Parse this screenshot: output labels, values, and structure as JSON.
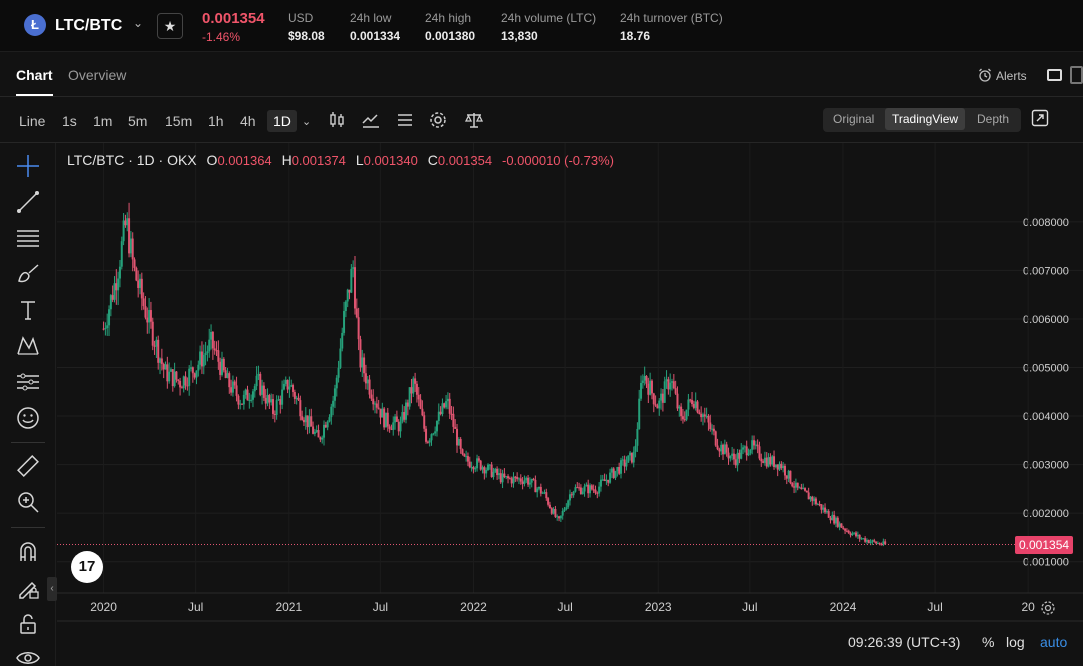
{
  "ticker": {
    "icon_letter": "Ł",
    "pair": "LTC/BTC",
    "price": "0.001354",
    "change": "-1.46%",
    "stats": [
      {
        "label": "USD",
        "value": "$98.08"
      },
      {
        "label": "24h low",
        "value": "0.001334"
      },
      {
        "label": "24h high",
        "value": "0.001380"
      },
      {
        "label": "24h volume (LTC)",
        "value": "13,830"
      },
      {
        "label": "24h turnover (BTC)",
        "value": "18.76"
      }
    ]
  },
  "tabs": {
    "chart": "Chart",
    "overview": "Overview",
    "alerts": "Alerts"
  },
  "toolbar": {
    "timeframes": [
      "Line",
      "1s",
      "1m",
      "5m",
      "15m",
      "1h",
      "4h",
      "1D"
    ],
    "views": [
      "Original",
      "TradingView",
      "Depth"
    ]
  },
  "legend": {
    "symbol": "LTC/BTC · 1D · OKX",
    "o_label": "O",
    "o": "0.001364",
    "h_label": "H",
    "h": "0.001374",
    "l_label": "L",
    "l": "0.001340",
    "c_label": "C",
    "c": "0.001354",
    "change": "-0.000010 (-0.73%)"
  },
  "status": {
    "time": "09:26:39 (UTC+3)",
    "percent": "%",
    "log": "log",
    "auto": "auto"
  },
  "tv_logo": "17",
  "colors": {
    "up": "#26a17b",
    "down": "#e05571",
    "accent": "#f0556a"
  },
  "chart_data": {
    "type": "candlestick",
    "title": "LTC/BTC · 1D · OKX",
    "y_ticks": [
      "0.008000",
      "0.007000",
      "0.006000",
      "0.005000",
      "0.004000",
      "0.003000",
      "0.002000",
      "0.001000"
    ],
    "ylim": [
      0.0005,
      0.0088
    ],
    "x_ticks": [
      "2020",
      "Jul",
      "2021",
      "Jul",
      "2022",
      "Jul",
      "2023",
      "Jul",
      "2024",
      "Jul",
      "20"
    ],
    "xlim": [
      "2019-10-01",
      "2024-11-30"
    ],
    "last_price": "0.001354",
    "series_outline": [
      [
        "2020-01-01",
        0.0058
      ],
      [
        "2020-01-25",
        0.0068
      ],
      [
        "2020-02-15",
        0.008
      ],
      [
        "2020-03-01",
        0.007
      ],
      [
        "2020-03-20",
        0.0063
      ],
      [
        "2020-04-10",
        0.0056
      ],
      [
        "2020-05-01",
        0.0049
      ],
      [
        "2020-06-01",
        0.0047
      ],
      [
        "2020-07-01",
        0.005
      ],
      [
        "2020-08-01",
        0.0055
      ],
      [
        "2020-09-01",
        0.0047
      ],
      [
        "2020-10-01",
        0.0043
      ],
      [
        "2020-11-01",
        0.0047
      ],
      [
        "2020-12-01",
        0.0041
      ],
      [
        "2021-01-01",
        0.0047
      ],
      [
        "2021-02-01",
        0.004
      ],
      [
        "2021-03-01",
        0.0035
      ],
      [
        "2021-04-01",
        0.0044
      ],
      [
        "2021-04-20",
        0.006
      ],
      [
        "2021-05-08",
        0.0071
      ],
      [
        "2021-05-20",
        0.0052
      ],
      [
        "2021-06-10",
        0.0046
      ],
      [
        "2021-07-10",
        0.0039
      ],
      [
        "2021-08-10",
        0.0038
      ],
      [
        "2021-09-05",
        0.0047
      ],
      [
        "2021-10-01",
        0.0035
      ],
      [
        "2021-11-10",
        0.0043
      ],
      [
        "2021-12-10",
        0.0031
      ],
      [
        "2022-01-15",
        0.003
      ],
      [
        "2022-03-01",
        0.0027
      ],
      [
        "2022-04-15",
        0.0027
      ],
      [
        "2022-05-20",
        0.0024
      ],
      [
        "2022-06-18",
        0.0018
      ],
      [
        "2022-07-15",
        0.0025
      ],
      [
        "2022-09-01",
        0.0025
      ],
      [
        "2022-10-01",
        0.0028
      ],
      [
        "2022-11-15",
        0.0032
      ],
      [
        "2022-12-01",
        0.0049
      ],
      [
        "2023-01-01",
        0.0042
      ],
      [
        "2023-01-25",
        0.0048
      ],
      [
        "2023-02-15",
        0.0039
      ],
      [
        "2023-03-10",
        0.0044
      ],
      [
        "2023-04-01",
        0.004
      ],
      [
        "2023-05-01",
        0.0034
      ],
      [
        "2023-06-01",
        0.0031
      ],
      [
        "2023-07-01",
        0.0034
      ],
      [
        "2023-08-01",
        0.0031
      ],
      [
        "2023-09-01",
        0.003
      ],
      [
        "2023-10-01",
        0.0025
      ],
      [
        "2023-11-01",
        0.0023
      ],
      [
        "2023-12-01",
        0.002
      ],
      [
        "2024-01-01",
        0.0017
      ],
      [
        "2024-02-01",
        0.0015
      ],
      [
        "2024-03-01",
        0.0014
      ],
      [
        "2024-03-25",
        0.00135
      ]
    ]
  }
}
